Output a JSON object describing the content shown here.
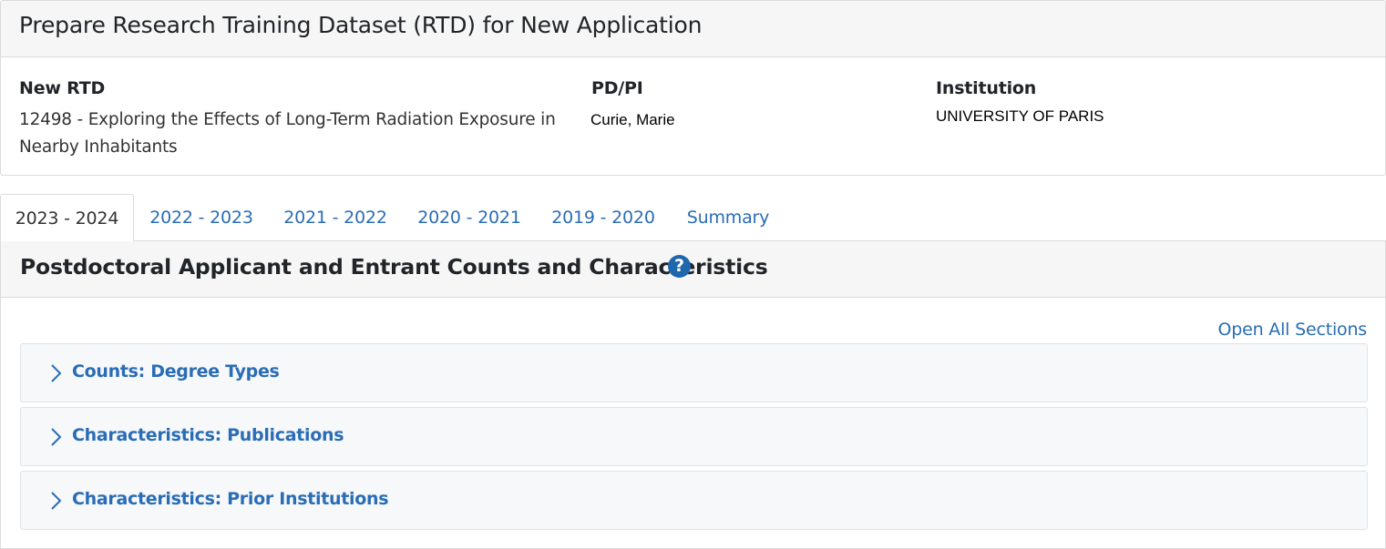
{
  "page_title": "Prepare Research Training Dataset (RTD) for New Application",
  "info": {
    "rtd_label": "New RTD",
    "rtd_value": "12498 - Exploring the Effects of Long-Term Radiation Exposure in Nearby Inhabitants",
    "pi_label": "PD/PI",
    "pi_value": "Curie, Marie",
    "institution_label": "Institution",
    "institution_value": "UNIVERSITY OF PARIS"
  },
  "tabs": [
    {
      "label": "2023 - 2024",
      "active": true
    },
    {
      "label": "2022 - 2023",
      "active": false
    },
    {
      "label": "2021 - 2022",
      "active": false
    },
    {
      "label": "2020 - 2021",
      "active": false
    },
    {
      "label": "2019 - 2020",
      "active": false
    },
    {
      "label": "Summary",
      "active": false
    }
  ],
  "section": {
    "title": "Postdoctoral Applicant and Entrant Counts and Characteristics",
    "help_icon": "question-circle-icon",
    "open_all_label": "Open All Sections",
    "accordion": [
      {
        "label": "Counts: Degree Types",
        "icon": "chevron-right-icon"
      },
      {
        "label": "Characteristics: Publications",
        "icon": "chevron-right-icon"
      },
      {
        "label": "Characteristics: Prior Institutions",
        "icon": "chevron-right-icon"
      }
    ]
  },
  "colors": {
    "link": "#2a6db5",
    "help_icon_bg": "#1f67ad",
    "header_bg": "#f6f6f6",
    "accordion_bg": "#f7f8fa",
    "border": "#dcdcdc"
  }
}
